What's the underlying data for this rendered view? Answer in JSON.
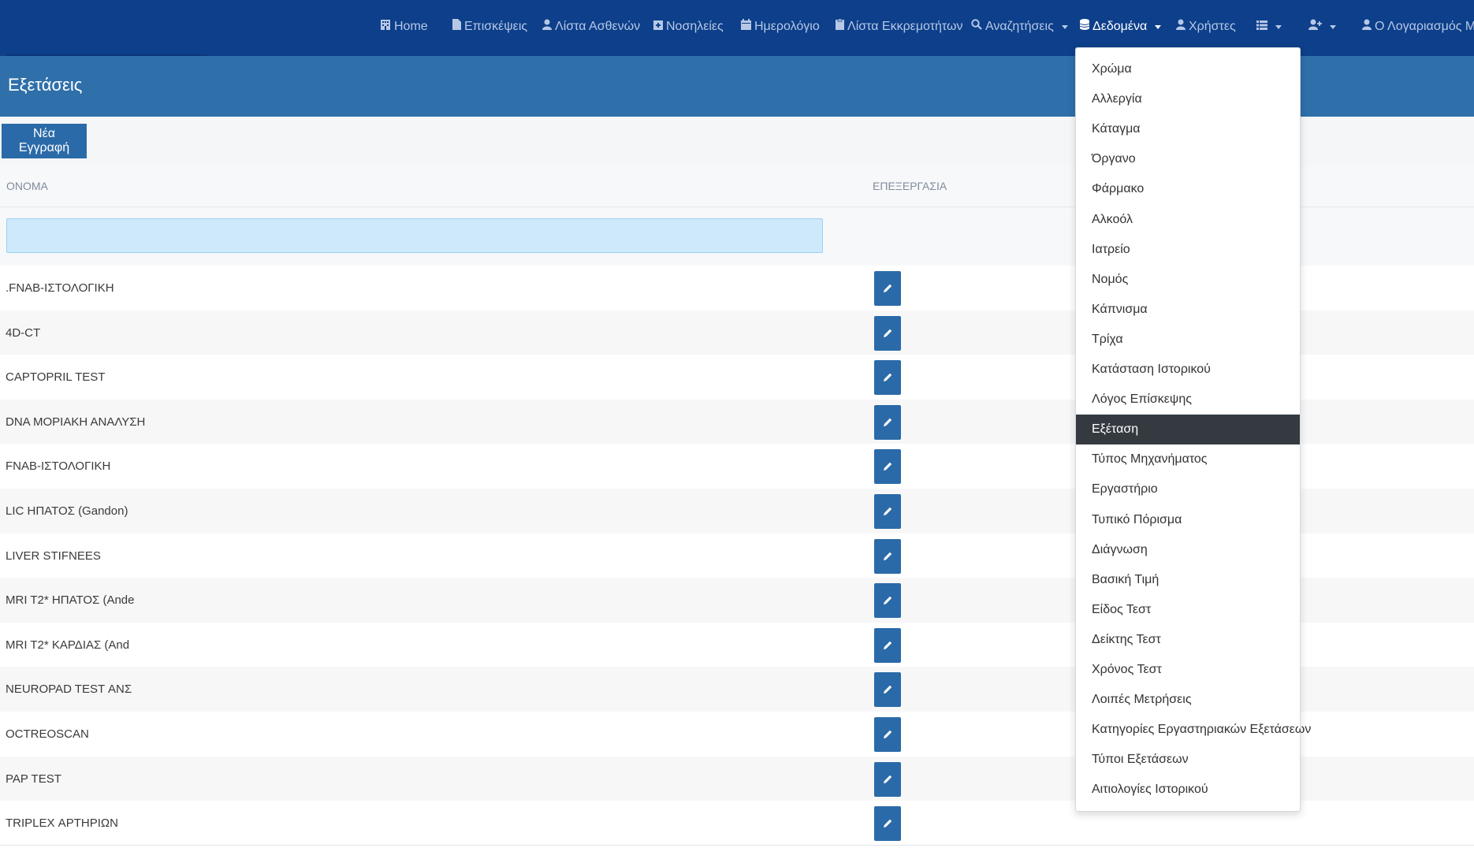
{
  "navbar": {
    "items": [
      {
        "label": "Home",
        "icon": "building-icon"
      },
      {
        "label": "Επισκέψεις",
        "icon": "file-icon"
      },
      {
        "label": "Λίστα Ασθενών",
        "icon": "user-icon"
      },
      {
        "label": "Νοσηλείες",
        "icon": "hospital-icon"
      },
      {
        "label": "Ημερολόγιο",
        "icon": "calendar-icon"
      },
      {
        "label": "Λίστα Εκκρεμοτήτων",
        "icon": "clipboard-icon"
      },
      {
        "label": "Αναζητήσεις",
        "icon": "search-icon",
        "dropdown": true
      },
      {
        "label": "Δεδομένα",
        "icon": "database-icon",
        "dropdown": true,
        "active": true
      },
      {
        "label": "Χρήστες",
        "icon": "user-icon"
      },
      {
        "label": "",
        "icon": "list-icon",
        "dropdown": true
      },
      {
        "label": "",
        "icon": "user-plus-icon",
        "dropdown": true
      },
      {
        "label": "Ο Λογαριασμός Μου",
        "icon": "user-icon",
        "dropdown": true
      }
    ]
  },
  "page": {
    "title": "Εξετάσεις",
    "new_button": "Νέα Εγγραφή"
  },
  "table": {
    "columns": {
      "name": "ΟΝΟΜΑ",
      "processing": "ΕΠΕΞΕΡΓΑΣΙΑ"
    },
    "rows": [
      ".FNAB-ΙΣΤΟΛΟΓΙΚΗ",
      "4D-CT",
      "CAPTOPRIL TEST",
      "DNA ΜΟΡΙΑΚΗ ΑΝΑΛΥΣΗ",
      "FNAB-ΙΣΤΟΛΟΓΙΚΗ",
      "LIC ΗΠΑΤΟΣ (Gandon)",
      "LIVER STIFNEES",
      "MRI T2* ΗΠΑΤΟΣ (Ande",
      "MRI T2* ΚΑΡΔΙΑΣ (And",
      "NEUROPAD TEST ΑΝΣ",
      "OCTREOSCAN",
      "PAP TEST",
      "TRIPLEX ΑΡΤΗΡΙΩΝ"
    ]
  },
  "dropdown": {
    "items": [
      "Χρώμα",
      "Αλλεργία",
      "Κάταγμα",
      "Όργανο",
      "Φάρμακο",
      "Αλκοόλ",
      "Ιατρείο",
      "Νομός",
      "Κάπνισμα",
      "Τρίχα",
      "Κατάσταση Ιστορικού",
      "Λόγος Επίσκεψης",
      "Εξέταση",
      "Τύπος Μηχανήματος",
      "Εργαστήριο",
      "Τυπικό Πόρισμα",
      "Διάγνωση",
      "Βασική Τιμή",
      "Είδος Τεστ",
      "Δείκτης Τεστ",
      "Χρόνος Τεστ",
      "Λοιπές Μετρήσεις",
      "Κατηγορίες Εργαστηριακών Εξετάσεων",
      "Τύποι Εξετάσεων",
      "Αιτιολογίες Ιστορικού"
    ],
    "active_index": 12
  },
  "colors": {
    "navbar": "#0d3f8a",
    "title_band": "#2f6faa",
    "button": "#2b6aa8",
    "dropdown_active": "#343a40",
    "filter_input": "#cde9fb"
  }
}
